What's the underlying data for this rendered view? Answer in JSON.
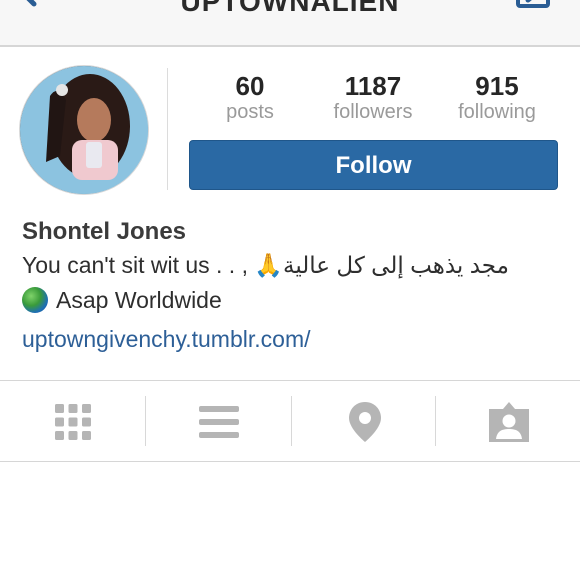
{
  "header": {
    "title": "UPTOWNALIEN",
    "back_icon": "back-arrow-icon",
    "share_icon": "share-icon"
  },
  "profile": {
    "avatar_icon": "avatar",
    "stats": [
      {
        "value": "60",
        "label": "posts"
      },
      {
        "value": "1187",
        "label": "followers"
      },
      {
        "value": "915",
        "label": "following"
      }
    ],
    "follow_label": "Follow",
    "name": "Shontel Jones",
    "bio_line1": "You can't sit wit us . . , 🙏مجد يذهب إلى كل عالية",
    "bio_line2": "Asap Worldwide",
    "website": "uptowngivenchy.tumblr.com/"
  },
  "tabs": [
    {
      "name": "grid-view",
      "icon": "grid-icon"
    },
    {
      "name": "list-view",
      "icon": "list-icon"
    },
    {
      "name": "map-view",
      "icon": "location-pin-icon"
    },
    {
      "name": "tagged-photos",
      "icon": "tagged-person-icon"
    }
  ],
  "colors": {
    "accent": "#2a69a4",
    "link": "#2d5f97",
    "icon_gray": "#b5b5b5"
  }
}
